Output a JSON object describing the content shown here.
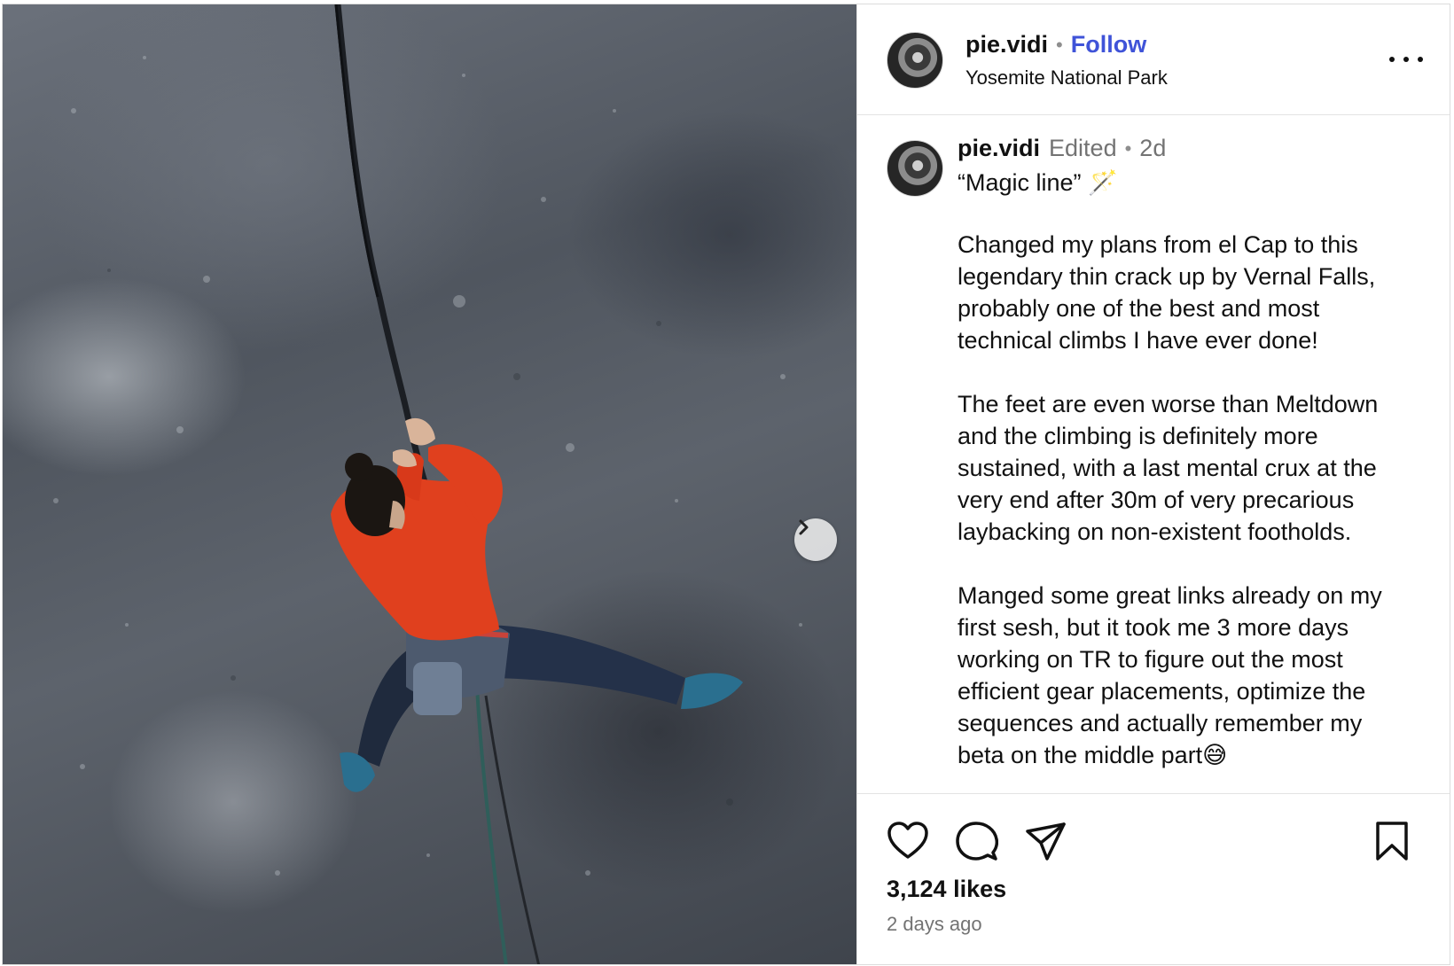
{
  "post": {
    "username": "pie.vidi",
    "follow_label": "Follow",
    "location": "Yosemite National Park",
    "edited_label": "Edited",
    "age_short": "2d",
    "caption_title": "“Magic line” 🪄",
    "caption_paragraphs": [
      "Changed my plans from el Cap to this\nlegendary thin crack up by Vernal Falls,\nprobably one of the best and most\ntechnical climbs I have ever done!",
      "The feet are even worse than Meltdown\nand the climbing is definitely more\nsustained, with a last mental crux at the\nvery end after 30m of very precarious\nlaybacking on non-existent footholds.",
      "Manged some great links already on my\nfirst sesh, but it took me 3 more days\nworking on TR to figure out the most\nefficient gear placements, optimize the\nsequences and actually remember my\nbeta on the middle part😅"
    ],
    "likes": "3,124 likes",
    "posted_ago": "2 days ago"
  },
  "colors": {
    "follow": "#3f53d8",
    "muted": "#737373",
    "jacket": "#e0401e"
  },
  "icons": {
    "next": "chevron-right-icon",
    "more": "more-horizontal-icon",
    "like": "heart-icon",
    "comment": "comment-icon",
    "share": "send-icon",
    "save": "bookmark-icon"
  }
}
